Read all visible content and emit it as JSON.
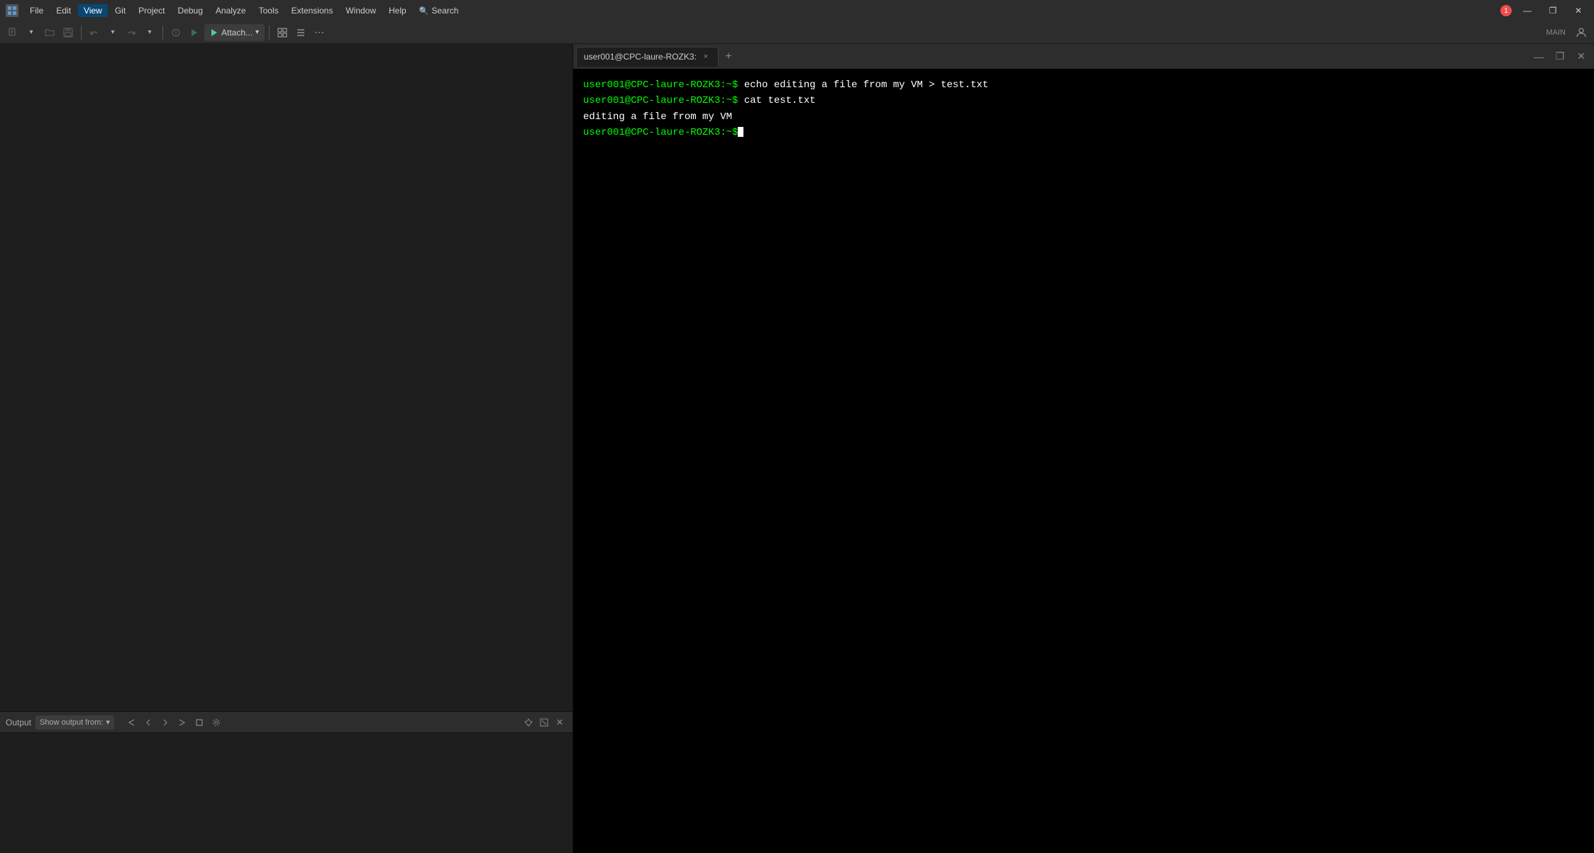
{
  "titlebar": {
    "menu_items": [
      "File",
      "Edit",
      "View",
      "Git",
      "Project",
      "Debug",
      "Analyze",
      "Tools",
      "Extensions",
      "Window",
      "Help"
    ],
    "search_label": "Search",
    "notification_count": "1",
    "win_minimize": "—",
    "win_restore": "❐",
    "win_close": "✕",
    "active_menu": "View"
  },
  "toolbar": {
    "main_label": "MAIN",
    "attach_label": "Attach...",
    "chevron": "▾"
  },
  "terminal": {
    "tab_label": "user001@CPC-laure-ROZK3:",
    "tab_close": "×",
    "add_tab": "+",
    "line1_prompt": "user001@CPC-laure-ROZK3:~$",
    "line1_cmd": " echo editing a file from my VM > test.txt",
    "line2_prompt": "user001@CPC-laure-ROZK3:~$",
    "line2_cmd": " cat test.txt",
    "line3_output": "editing a file from my VM",
    "line4_prompt": "user001@CPC-laure-ROZK3:~$"
  },
  "output": {
    "title": "Output",
    "show_output_from": "Show output from:",
    "dropdown_arrow": "▾"
  }
}
